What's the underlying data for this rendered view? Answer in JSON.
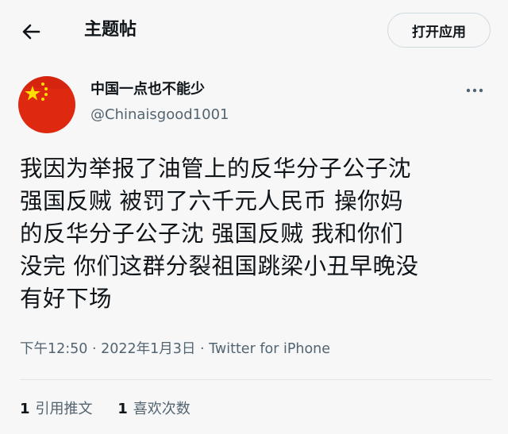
{
  "header": {
    "back_icon": "arrow-left-icon",
    "title": "主题帖",
    "open_app_label": "打开应用"
  },
  "author": {
    "display_name": "中国一点也不能少",
    "handle": "@Chinaisgood1001",
    "avatar_icon": "china-flag-avatar"
  },
  "more_icon": "more-horizontal-icon",
  "tweet": {
    "text": "我因为举报了油管上的反华分子公子沈\n强国反贼 被罚了六千元人民币 操你妈\n的反华分子公子沈 强国反贼 我和你们\n没完 你们这群分裂祖国跳梁小丑早晚没\n有好下场",
    "meta": "下午12:50 · 2022年1月3日 · Twitter for iPhone"
  },
  "stats": {
    "quotes_count": "1",
    "quotes_label": "引用推文",
    "likes_count": "1",
    "likes_label": "喜欢次数"
  },
  "colors": {
    "background": "#f7f7f7",
    "text_primary": "#0f1419",
    "text_secondary": "#536471",
    "flag_red": "#de2910",
    "flag_yellow": "#ffde00"
  }
}
